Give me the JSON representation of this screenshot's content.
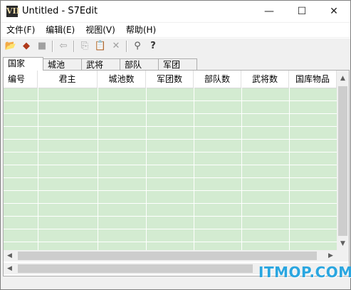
{
  "window": {
    "title": "Untitled - S7Edit",
    "app_icon_text": "VII"
  },
  "window_buttons": {
    "minimize": "—",
    "maximize": "☐",
    "close": "✕"
  },
  "menu": [
    {
      "label": "文件(F)"
    },
    {
      "label": "编辑(E)"
    },
    {
      "label": "视图(V)"
    },
    {
      "label": "帮助(H)"
    }
  ],
  "toolbar": {
    "open_icon": "📂",
    "import_icon": "◆",
    "save_icon": "■",
    "back_icon": "⇦",
    "copy_icon": "⎘",
    "paste_icon": "📋",
    "delete_icon": "✕",
    "find_icon": "⚲",
    "help_icon": "?"
  },
  "tabs": [
    {
      "label": "国家"
    },
    {
      "label": "城池"
    },
    {
      "label": "武将"
    },
    {
      "label": "部队"
    },
    {
      "label": "军团"
    }
  ],
  "table": {
    "columns": [
      {
        "label": "编号"
      },
      {
        "label": "君主"
      },
      {
        "label": "城池数"
      },
      {
        "label": "军团数"
      },
      {
        "label": "部队数"
      },
      {
        "label": "武将数"
      },
      {
        "label": "国库物品"
      }
    ]
  },
  "scroll": {
    "up": "▲",
    "down": "▼",
    "left": "◀",
    "right": "▶"
  },
  "watermark": "ITMOP.COM",
  "colors": {
    "grid_background": "#d3ebd1",
    "watermark": "#2aa6e0"
  }
}
